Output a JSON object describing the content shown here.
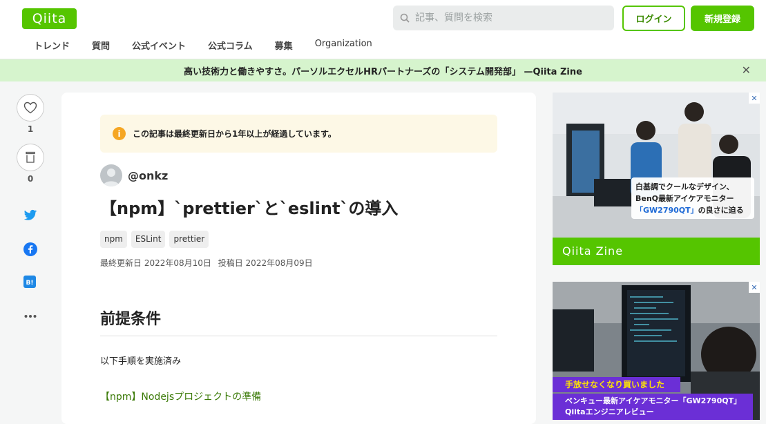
{
  "header": {
    "logo": "Qiita",
    "search_placeholder": "記事、質問を検索",
    "login": "ログイン",
    "signup": "新規登録"
  },
  "nav": [
    "トレンド",
    "質問",
    "公式イベント",
    "公式コラム",
    "募集",
    "Organization"
  ],
  "banner": {
    "text": "高い技術力と働きやすさ。パーソルエクセルHRパートナーズの「システム開発部」 —Qiita Zine"
  },
  "rail": {
    "likes": "1",
    "stocks": "0"
  },
  "article": {
    "notice": "この記事は最終更新日から1年以上が経過しています。",
    "author": "@onkz",
    "title": "【npm】`prettier`と`eslint`の導入",
    "tags": [
      "npm",
      "ESLint",
      "prettier"
    ],
    "updated": "最終更新日 2022年08月10日",
    "posted": "投稿日 2022年08月09日",
    "h2": "前提条件",
    "p1": "以下手順を実施済み",
    "link": "【npm】Nodejsプロジェクトの準備"
  },
  "ads": {
    "ad1": {
      "caption_line1": "白基調でクールなデザイン、",
      "caption_line2": "BenQ最新アイケアモニター",
      "caption_line3a": "「GW2790QT」",
      "caption_line3b": "の良さに迫る",
      "brand": "Qiita Zine"
    },
    "ad2": {
      "caption_line1": "手放せなくなり買いました",
      "caption_line2": "ベンキュー最新アイケアモニター「GW2790QT」",
      "caption_line3": "Qiitaエンジニアレビュー"
    }
  },
  "colors": {
    "brand": "#55c500",
    "banner": "#d6f4cd",
    "notice": "#fdf8e6"
  }
}
